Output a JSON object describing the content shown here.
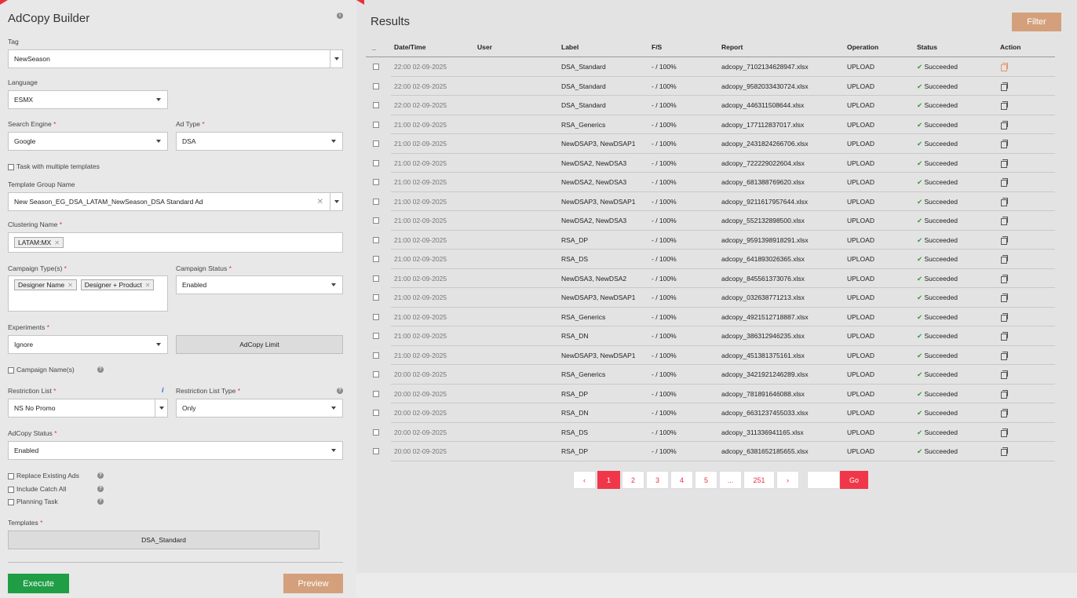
{
  "builder": {
    "title": "AdCopy Builder",
    "tag": {
      "label": "Tag",
      "value": "NewSeason"
    },
    "language": {
      "label": "Language",
      "value": "ESMX"
    },
    "search_engine": {
      "label": "Search Engine",
      "value": "Google"
    },
    "ad_type": {
      "label": "Ad Type",
      "value": "DSA"
    },
    "multi_templates_label": "Task with multiple templates",
    "template_group": {
      "label": "Template Group Name",
      "value": "New Season_EG_DSA_LATAM_NewSeason_DSA Standard Ad"
    },
    "clustering": {
      "label": "Clustering Name",
      "tags": [
        "LATAM:MX"
      ]
    },
    "campaign_types": {
      "label": "Campaign Type(s)",
      "tags": [
        "Designer Name",
        "Designer + Product"
      ]
    },
    "campaign_status": {
      "label": "Campaign Status",
      "value": "Enabled"
    },
    "experiments": {
      "label": "Experiments",
      "value": "Ignore"
    },
    "adcopy_limit_label": "AdCopy Limit",
    "campaign_names_label": "Campaign Name(s)",
    "restriction_list": {
      "label": "Restriction List",
      "value": "NS No Promo"
    },
    "restriction_list_type": {
      "label": "Restriction List Type",
      "value": "Only"
    },
    "adcopy_status": {
      "label": "AdCopy Status",
      "value": "Enabled"
    },
    "replace_existing_label": "Replace Existing Ads",
    "include_catch_all_label": "Include Catch All",
    "planning_task_label": "Planning Task",
    "templates_label": "Templates",
    "template_button": "DSA_Standard",
    "execute_label": "Execute",
    "preview_label": "Preview"
  },
  "results": {
    "title": "Results",
    "filter_label": "Filter",
    "columns": {
      "select": "_",
      "datetime": "Date/Time",
      "user": "User",
      "label": "Label",
      "fs": "F/S",
      "report": "Report",
      "operation": "Operation",
      "status": "Status",
      "action": "Action"
    },
    "rows": [
      {
        "datetime": "22:00 02-09-2025",
        "user": "",
        "label": "DSA_Standard",
        "fs": "- / 100%",
        "report": "adcopy_7102134628947.xlsx",
        "operation": "UPLOAD",
        "status": "Succeeded"
      },
      {
        "datetime": "22:00 02-09-2025",
        "user": "",
        "label": "DSA_Standard",
        "fs": "- / 100%",
        "report": "adcopy_9582033430724.xlsx",
        "operation": "UPLOAD",
        "status": "Succeeded"
      },
      {
        "datetime": "22:00 02-09-2025",
        "user": "",
        "label": "DSA_Standard",
        "fs": "- / 100%",
        "report": "adcopy_446311508644.xlsx",
        "operation": "UPLOAD",
        "status": "Succeeded"
      },
      {
        "datetime": "21:00 02-09-2025",
        "user": "",
        "label": "RSA_Generics",
        "fs": "- / 100%",
        "report": "adcopy_177112837017.xlsx",
        "operation": "UPLOAD",
        "status": "Succeeded"
      },
      {
        "datetime": "21:00 02-09-2025",
        "user": "",
        "label": "NewDSAP3, NewDSAP1",
        "fs": "- / 100%",
        "report": "adcopy_2431824266706.xlsx",
        "operation": "UPLOAD",
        "status": "Succeeded"
      },
      {
        "datetime": "21:00 02-09-2025",
        "user": "",
        "label": "NewDSA2, NewDSA3",
        "fs": "- / 100%",
        "report": "adcopy_722229022604.xlsx",
        "operation": "UPLOAD",
        "status": "Succeeded"
      },
      {
        "datetime": "21:00 02-09-2025",
        "user": "",
        "label": "NewDSA2, NewDSA3",
        "fs": "- / 100%",
        "report": "adcopy_681388769620.xlsx",
        "operation": "UPLOAD",
        "status": "Succeeded"
      },
      {
        "datetime": "21:00 02-09-2025",
        "user": "",
        "label": "NewDSAP3, NewDSAP1",
        "fs": "- / 100%",
        "report": "adcopy_9211617957644.xlsx",
        "operation": "UPLOAD",
        "status": "Succeeded"
      },
      {
        "datetime": "21:00 02-09-2025",
        "user": "",
        "label": "NewDSA2, NewDSA3",
        "fs": "- / 100%",
        "report": "adcopy_552132898500.xlsx",
        "operation": "UPLOAD",
        "status": "Succeeded"
      },
      {
        "datetime": "21:00 02-09-2025",
        "user": "",
        "label": "RSA_DP",
        "fs": "- / 100%",
        "report": "adcopy_9591398918291.xlsx",
        "operation": "UPLOAD",
        "status": "Succeeded"
      },
      {
        "datetime": "21:00 02-09-2025",
        "user": "",
        "label": "RSA_DS",
        "fs": "- / 100%",
        "report": "adcopy_641893026365.xlsx",
        "operation": "UPLOAD",
        "status": "Succeeded"
      },
      {
        "datetime": "21:00 02-09-2025",
        "user": "",
        "label": "NewDSA3, NewDSA2",
        "fs": "- / 100%",
        "report": "adcopy_845561373076.xlsx",
        "operation": "UPLOAD",
        "status": "Succeeded"
      },
      {
        "datetime": "21:00 02-09-2025",
        "user": "",
        "label": "NewDSAP3, NewDSAP1",
        "fs": "- / 100%",
        "report": "adcopy_032638771213.xlsx",
        "operation": "UPLOAD",
        "status": "Succeeded"
      },
      {
        "datetime": "21:00 02-09-2025",
        "user": "",
        "label": "RSA_Generics",
        "fs": "- / 100%",
        "report": "adcopy_4921512718887.xlsx",
        "operation": "UPLOAD",
        "status": "Succeeded"
      },
      {
        "datetime": "21:00 02-09-2025",
        "user": "",
        "label": "RSA_DN",
        "fs": "- / 100%",
        "report": "adcopy_386312946235.xlsx",
        "operation": "UPLOAD",
        "status": "Succeeded"
      },
      {
        "datetime": "21:00 02-09-2025",
        "user": "",
        "label": "NewDSAP3, NewDSAP1",
        "fs": "- / 100%",
        "report": "adcopy_451381375161.xlsx",
        "operation": "UPLOAD",
        "status": "Succeeded"
      },
      {
        "datetime": "20:00 02-09-2025",
        "user": "",
        "label": "RSA_Generics",
        "fs": "- / 100%",
        "report": "adcopy_3421921246289.xlsx",
        "operation": "UPLOAD",
        "status": "Succeeded"
      },
      {
        "datetime": "20:00 02-09-2025",
        "user": "",
        "label": "RSA_DP",
        "fs": "- / 100%",
        "report": "adcopy_781891646088.xlsx",
        "operation": "UPLOAD",
        "status": "Succeeded"
      },
      {
        "datetime": "20:00 02-09-2025",
        "user": "",
        "label": "RSA_DN",
        "fs": "- / 100%",
        "report": "adcopy_6631237455033.xlsx",
        "operation": "UPLOAD",
        "status": "Succeeded"
      },
      {
        "datetime": "20:00 02-09-2025",
        "user": "",
        "label": "RSA_DS",
        "fs": "- / 100%",
        "report": "adcopy_311336941165.xlsx",
        "operation": "UPLOAD",
        "status": "Succeeded"
      },
      {
        "datetime": "20:00 02-09-2025",
        "user": "",
        "label": "RSA_DP",
        "fs": "- / 100%",
        "report": "adcopy_6381652185655.xlsx",
        "operation": "UPLOAD",
        "status": "Succeeded"
      }
    ],
    "pagination": {
      "prev": "‹",
      "pages": [
        "1",
        "2",
        "3",
        "4",
        "5",
        "...",
        "251"
      ],
      "next": "›",
      "current": "1",
      "go_label": "Go"
    }
  },
  "colors": {
    "accent_red": "#f0374a",
    "filter_tan": "#d4a07c",
    "execute_green": "#1f9e45",
    "success_green": "#2e9e3e"
  },
  "icons": {
    "row_action": "copy-icon",
    "status": "check-icon",
    "info": "info-icon",
    "help": "help-icon"
  }
}
